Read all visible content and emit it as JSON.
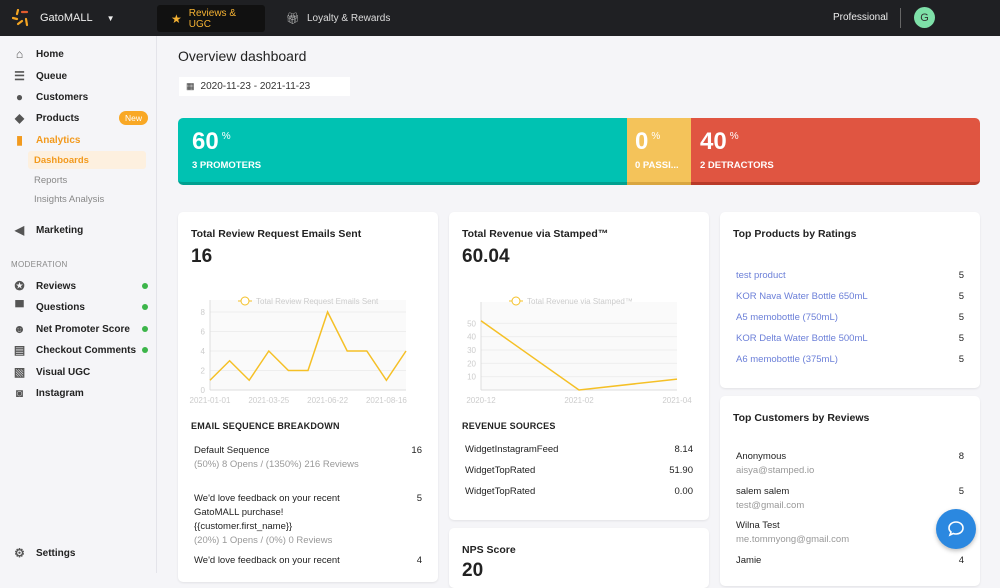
{
  "topbar": {
    "store": "GatoMALL",
    "tabs": [
      {
        "label": "Reviews & UGC",
        "icon": "star-icon"
      },
      {
        "label": "Loyalty & Rewards",
        "icon": "gift-icon"
      }
    ],
    "plan": "Professional",
    "avatar": "G"
  },
  "sidebar": {
    "items": [
      {
        "label": "Home"
      },
      {
        "label": "Queue"
      },
      {
        "label": "Customers"
      },
      {
        "label": "Products",
        "badge": "New"
      },
      {
        "label": "Analytics"
      }
    ],
    "analytics_sub": [
      "Dashboards",
      "Reports",
      "Insights Analysis"
    ],
    "marketing": "Marketing",
    "section": "MODERATION",
    "moderation": [
      {
        "label": "Reviews",
        "dot": true
      },
      {
        "label": "Questions",
        "dot": true
      },
      {
        "label": "Net Promoter Score",
        "dot": true
      },
      {
        "label": "Checkout Comments",
        "dot": true
      },
      {
        "label": "Visual UGC"
      },
      {
        "label": "Instagram"
      }
    ],
    "settings": "Settings"
  },
  "page": {
    "title": "Overview dashboard",
    "date_range": "2020-11-23 - 2021-11-23"
  },
  "nps": [
    {
      "value": "60",
      "unit": "%",
      "label": "3 PROMOTERS",
      "color": "#00c2b2",
      "pct": 60
    },
    {
      "value": "0",
      "unit": "%",
      "label": "0 PASSI...",
      "color": "#f4c35a",
      "pct": 0
    },
    {
      "value": "40",
      "unit": "%",
      "label": "2 DETRACTORS",
      "color": "#e05541",
      "pct": 40
    }
  ],
  "emails": {
    "title": "Total Review Request Emails Sent",
    "value": "16",
    "breakdown_title": "EMAIL SEQUENCE BREAKDOWN",
    "sequences": [
      {
        "name": "Default Sequence",
        "count": "16",
        "meta": "(50%) 8 Opens / (1350%) 216 Reviews"
      },
      {
        "name": "We'd love feedback on your recent GatoMALL purchase! {{customer.first_name}}",
        "count": "5",
        "meta": "(20%) 1 Opens / (0%) 0 Reviews"
      },
      {
        "name": "We'd love feedback on your recent",
        "count": "4",
        "meta": ""
      }
    ]
  },
  "revenue": {
    "title": "Total Revenue via Stamped™",
    "value": "60.04",
    "sources_title": "REVENUE SOURCES",
    "sources": [
      {
        "name": "WidgetInstagramFeed",
        "value": "8.14"
      },
      {
        "name": "WidgetTopRated",
        "value": "51.90"
      },
      {
        "name": "WidgetTopRated",
        "value": "0.00"
      }
    ]
  },
  "nps_card": {
    "title": "NPS Score",
    "value": "20"
  },
  "top_products": {
    "title": "Top Products by Ratings",
    "items": [
      {
        "name": "test product",
        "rating": "5"
      },
      {
        "name": "KOR Nava Water Bottle 650mL",
        "rating": "5"
      },
      {
        "name": "A5 memobottle (750mL)",
        "rating": "5"
      },
      {
        "name": "KOR Delta Water Bottle 500mL",
        "rating": "5"
      },
      {
        "name": "A6 memobottle (375mL)",
        "rating": "5"
      }
    ]
  },
  "top_customers": {
    "title": "Top Customers by Reviews",
    "items": [
      {
        "name": "Anonymous",
        "email": "aisya@stamped.io",
        "count": "8"
      },
      {
        "name": "salem salem",
        "email": "test@gmail.com",
        "count": "5"
      },
      {
        "name": "Wilna Test",
        "email": "me.tommyong@gmail.com",
        "count": ""
      },
      {
        "name": "Jamie",
        "email": "",
        "count": "4"
      }
    ]
  },
  "chart_data": [
    {
      "type": "line",
      "legend": "Total Review Request Emails Sent",
      "color": "#f5c026",
      "x_ticks": [
        "2021-01-01",
        "2021-03-25",
        "2021-06-22",
        "2021-08-16"
      ],
      "tick_positions": [
        0,
        3,
        6,
        9
      ],
      "values": [
        1,
        3,
        1,
        4,
        2,
        2,
        8,
        4,
        4,
        1,
        4
      ],
      "yticks": [
        0,
        2,
        4,
        6,
        8
      ],
      "ylim": [
        0,
        8
      ]
    },
    {
      "type": "line",
      "legend": "Total Revenue via Stamped™",
      "color": "#f5c026",
      "x": [
        "2020-12",
        "2021-02",
        "2021-04"
      ],
      "values": [
        51.9,
        0,
        8.14
      ],
      "yticks": [
        10,
        20,
        30,
        40,
        50
      ],
      "ylim": [
        0,
        57
      ]
    }
  ]
}
